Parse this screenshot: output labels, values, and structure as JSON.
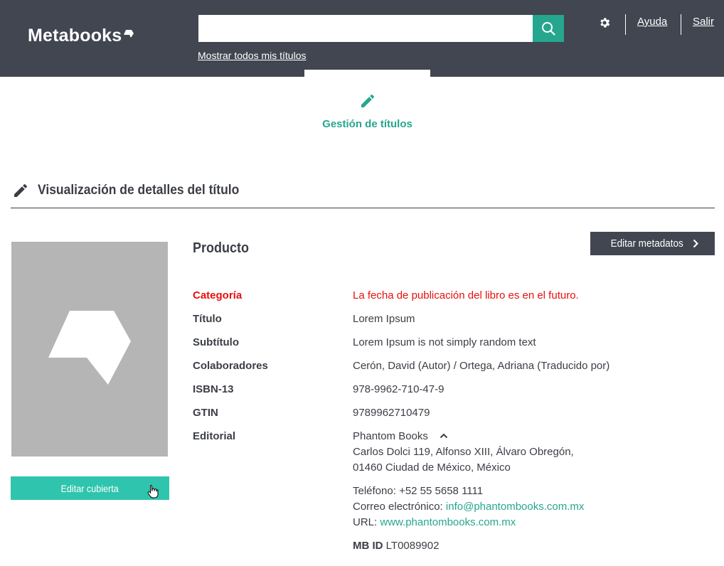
{
  "header": {
    "logo_text": "Metabooks",
    "search_value": "",
    "search_placeholder": "",
    "show_all_link": "Mostrar todos mis títulos",
    "help_link": "Ayuda",
    "logout_link": "Salir"
  },
  "module": {
    "label": "Gestión de títulos"
  },
  "section": {
    "title": "Visualización de detalles del título"
  },
  "cover": {
    "edit_button": "Editar cubierta"
  },
  "product": {
    "heading": "Producto",
    "edit_metadata_button": "Editar metadatos",
    "rows": [
      {
        "label": "Categoría",
        "value": "La fecha de publicación del libro es en el futuro."
      },
      {
        "label": "Título",
        "value": "Lorem Ipsum"
      },
      {
        "label": "Subtítulo",
        "value": "Lorem Ipsum is not simply random text"
      },
      {
        "label": "Colaboradores",
        "value": "Cerón, David (Autor) / Ortega, Adriana (Traducido por)"
      },
      {
        "label": "ISBN-13",
        "value": "978-9962-710-47-9"
      },
      {
        "label": "GTIN",
        "value": "9789962710479"
      },
      {
        "label": "Editorial",
        "value": "Phantom Books"
      }
    ],
    "publisher": {
      "address_line1": "Carlos Dolci 119, Alfonso XIII, Álvaro Obregón,",
      "address_line2": "01460 Ciudad de México, México",
      "phone_label": "Teléfono:",
      "phone": "+52 55 5658 1111",
      "email_label": "Correo electrónico:",
      "email": "info@phantombooks.com.mx",
      "url_label": "URL:",
      "url": "www.phantombooks.com.mx",
      "mbid_label": "MB ID",
      "mbid": "LT0089902"
    }
  },
  "colors": {
    "header_bg": "#414651",
    "accent": "#26a68f",
    "cover_button": "#2fc4ad",
    "warning": "#e8100b"
  }
}
